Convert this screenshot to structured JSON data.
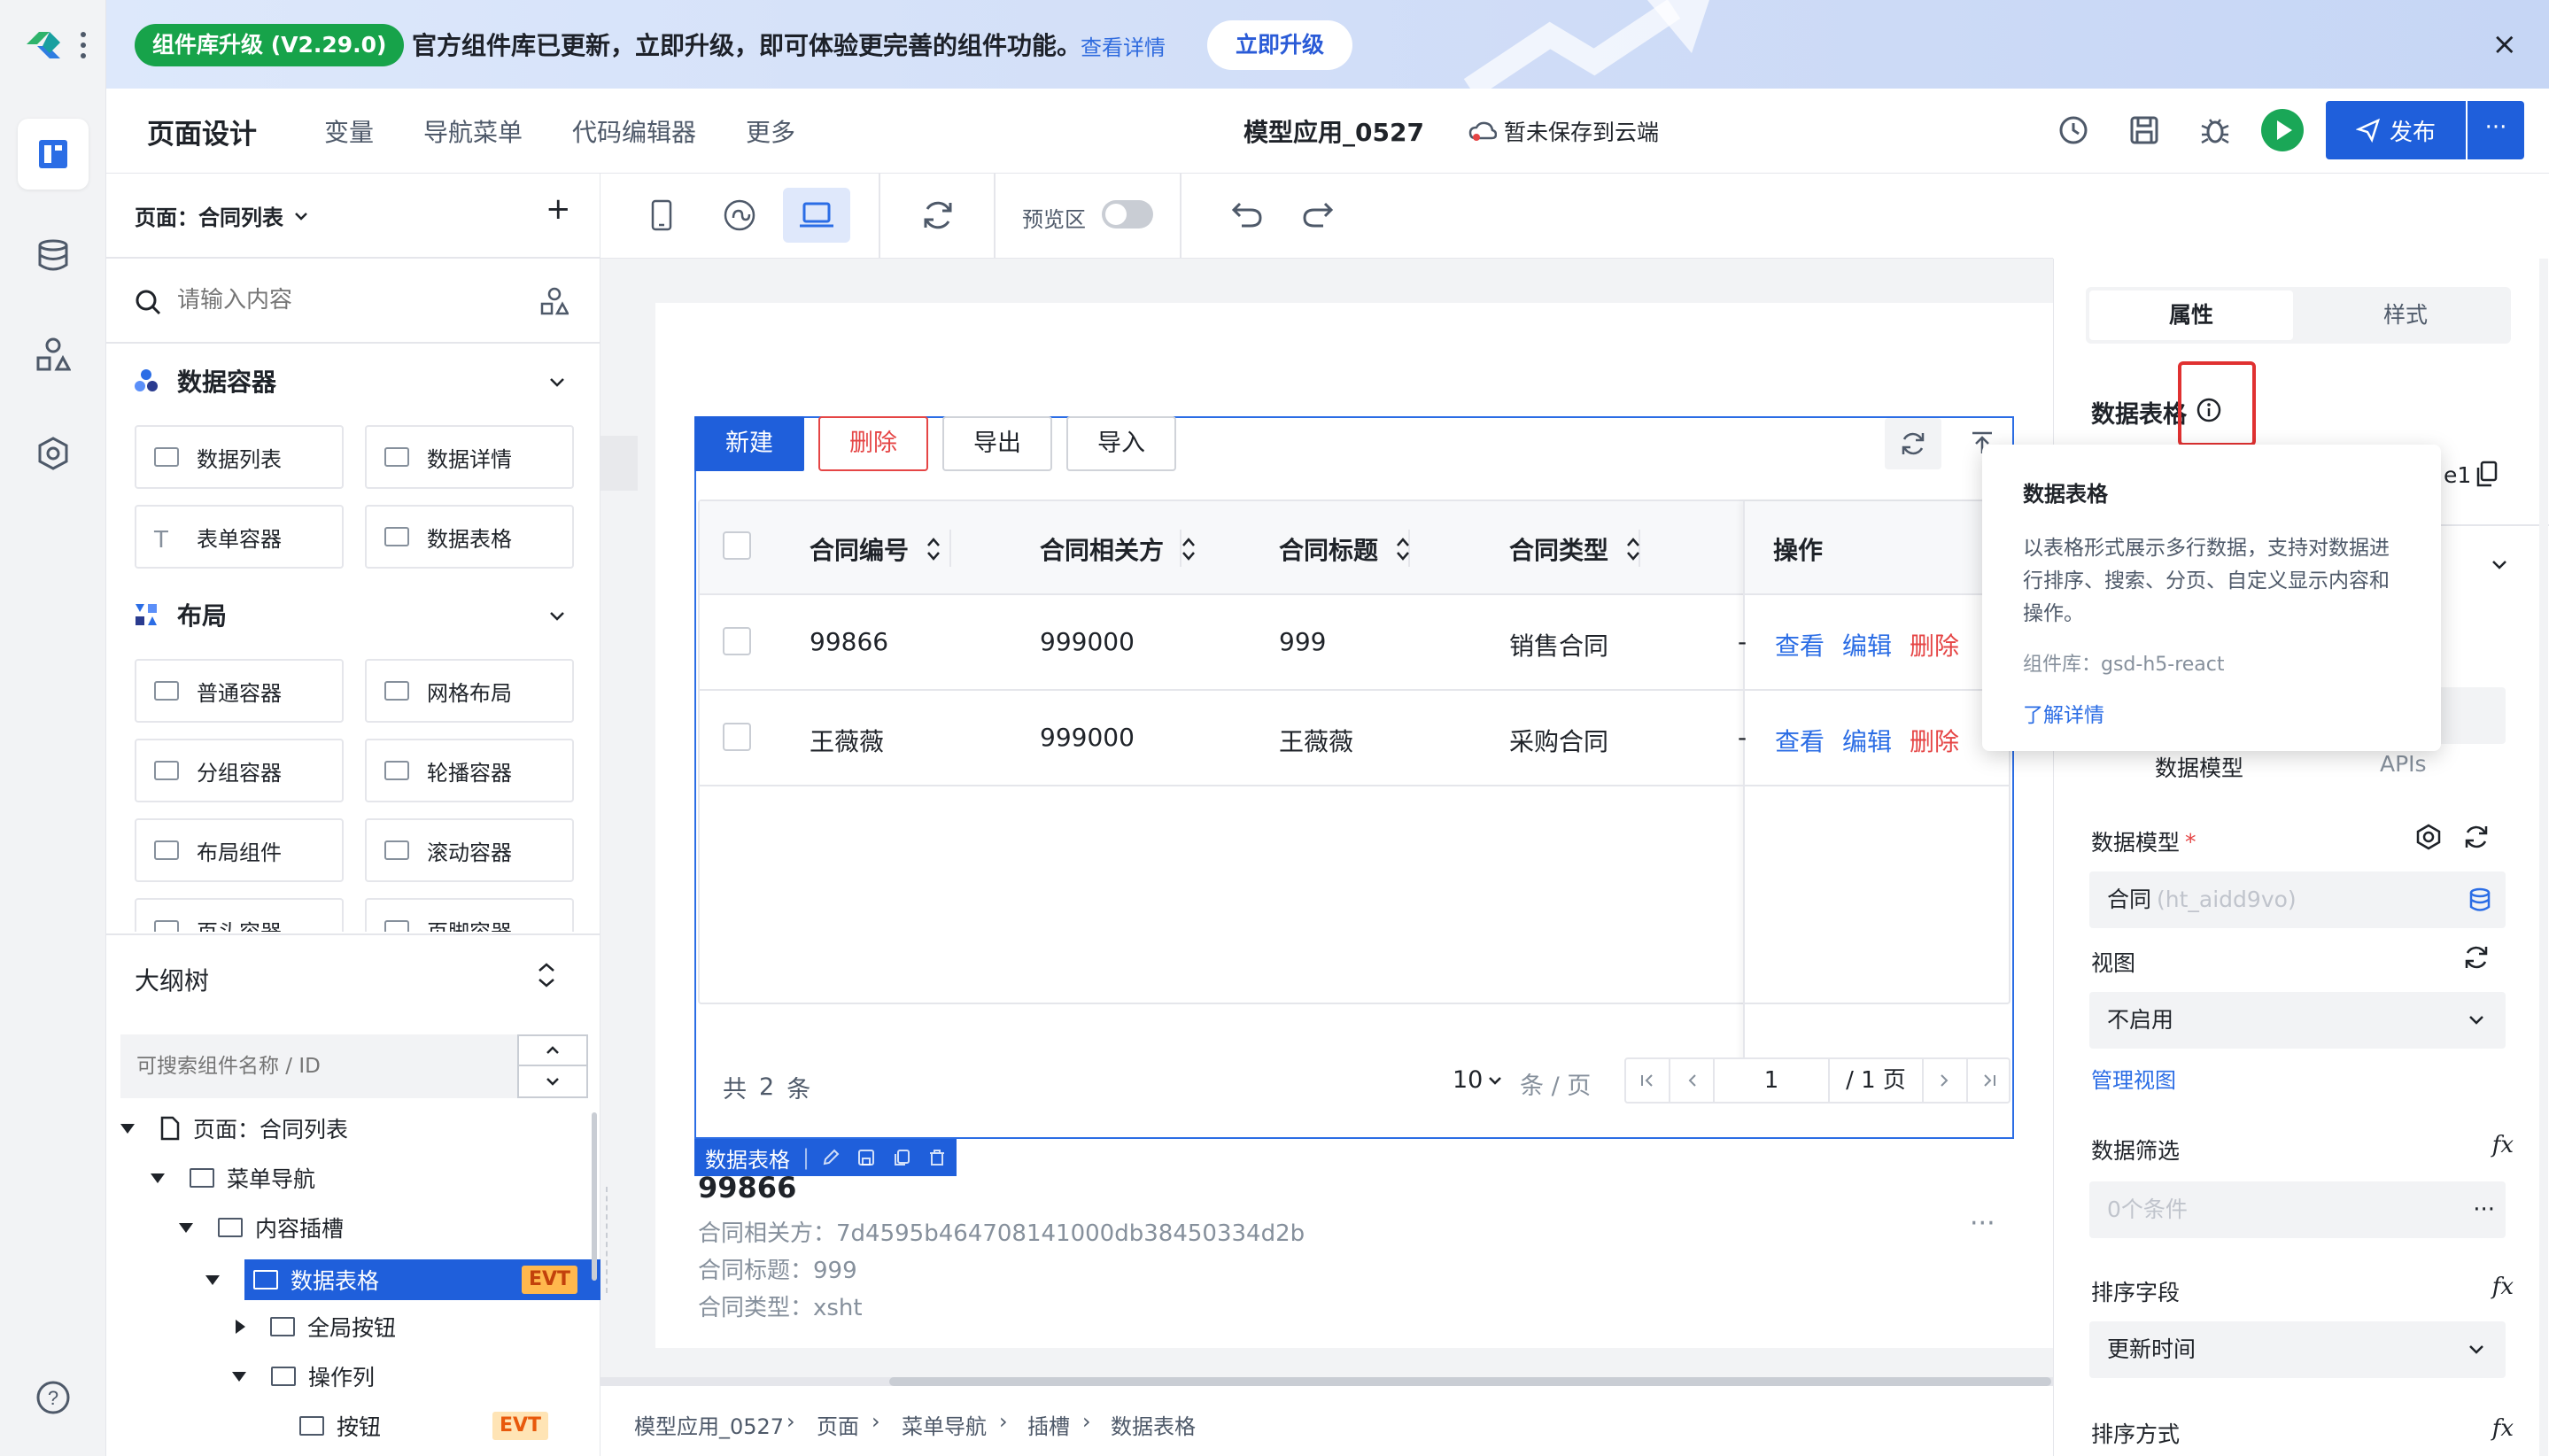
{
  "banner": {
    "badge": "组件库升级 (V2.29.0)",
    "message": "官方组件库已更新，立即升级，即可体验更完善的组件功能。",
    "more_link": "查看详情",
    "upgrade_button": "立即升级",
    "close": "×"
  },
  "header": {
    "title": "页面设计",
    "nav": [
      "变量",
      "导航菜单",
      "代码编辑器",
      "更多"
    ],
    "app_name": "模型应用_0527",
    "save_status": "暂未保存到云端",
    "publish": "发布",
    "more": "···"
  },
  "left": {
    "page_select": "页面：合同列表",
    "add": "+",
    "search_placeholder": "请输入内容",
    "sections": [
      {
        "title": "数据容器",
        "items": [
          "数据列表",
          "数据详情",
          "表单容器",
          "数据表格"
        ]
      },
      {
        "title": "布局",
        "items": [
          "普通容器",
          "网格布局",
          "分组容器",
          "轮播容器",
          "布局组件",
          "滚动容器",
          "页头容器",
          "页脚容器"
        ]
      }
    ],
    "outline": {
      "title": "大纲树",
      "search_placeholder": "可搜索组件名称 / ID",
      "nodes": [
        "页面：合同列表",
        "菜单导航",
        "内容插槽",
        "数据表格",
        "全局按钮",
        "操作列",
        "按钮"
      ],
      "evt": "EVT"
    }
  },
  "toolbar": {
    "preview_label": "预览区"
  },
  "table": {
    "buttons": [
      "新建",
      "删除",
      "导出",
      "导入"
    ],
    "columns": [
      "合同编号",
      "合同相关方",
      "合同标题",
      "合同类型",
      "操作"
    ],
    "rows": [
      {
        "id": "99866",
        "party": "999000",
        "title": "999",
        "type": "销售合同",
        "dash": "-"
      },
      {
        "id": "王薇薇",
        "party": "999000",
        "title": "王薇薇",
        "type": "采购合同",
        "dash": "-"
      }
    ],
    "actions": [
      "查看",
      "编辑",
      "删除"
    ],
    "total_prefix": "共",
    "total": "2",
    "total_suffix": "条",
    "page_size": "10",
    "page_size_unit": "条 / 页",
    "current_page": "1",
    "total_pages": "/ 1 页",
    "component_tag": "数据表格"
  },
  "detail": {
    "id": "99866",
    "party": "合同相关方：7d4595b464708141000db38450334d2b",
    "title": "合同标题：999",
    "type": "合同类型：xsht",
    "more": "···"
  },
  "right": {
    "tabs": [
      "属性",
      "样式"
    ],
    "component_title": "数据表格",
    "id_suffix": "e1",
    "sub_tabs": [
      "数据模型",
      "APIs"
    ],
    "model_label": "数据模型",
    "required": "*",
    "model_value": "合同",
    "model_code": "(ht_aidd9vo)",
    "view_label": "视图",
    "view_value": "不启用",
    "manage_view": "管理视图",
    "filter_label": "数据筛选",
    "filter_value": "0个条件",
    "sort_field_label": "排序字段",
    "sort_field_value": "更新时间",
    "sort_order_label": "排序方式",
    "fx": "fx"
  },
  "tooltip": {
    "title": "数据表格",
    "description": "以表格形式展示多行数据，支持对数据进行排序、搜索、分页、自定义显示内容和操作。",
    "library": "组件库：gsd-h5-react",
    "learn_more": "了解详情"
  },
  "breadcrumb": [
    "模型应用_0527",
    "页面",
    "菜单导航",
    "插槽",
    "数据表格"
  ],
  "colors": {
    "primary": "#2b6de5",
    "danger": "#e54545",
    "success": "#17a34a"
  }
}
